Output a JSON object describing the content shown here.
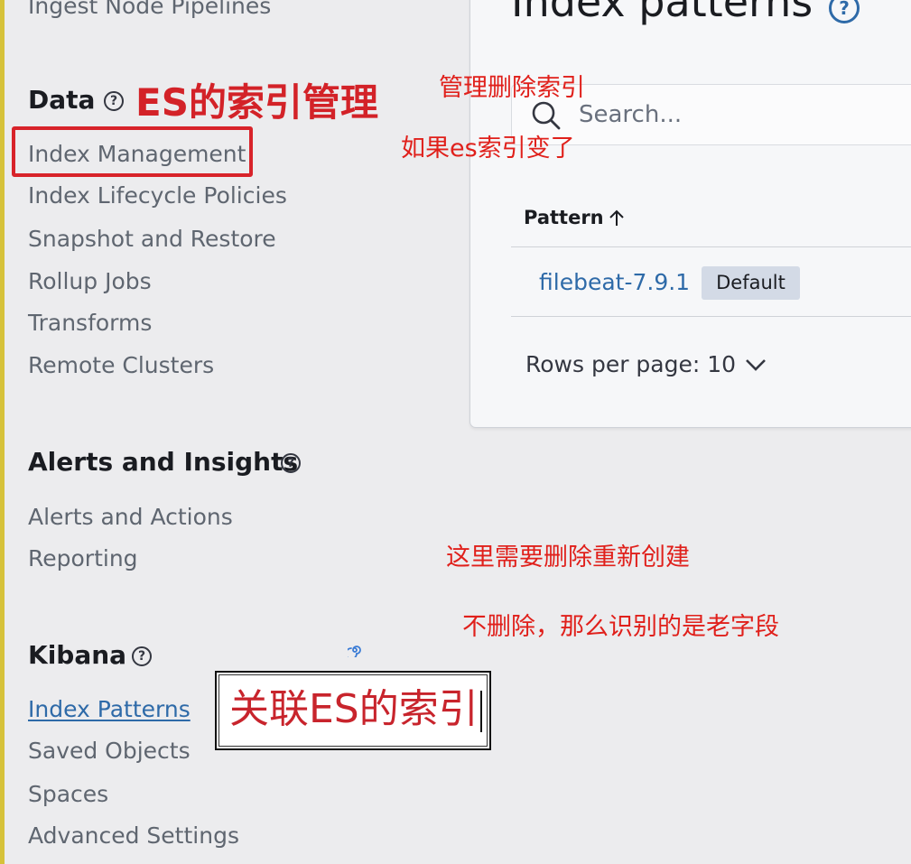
{
  "sidebar": {
    "top_cut_item": "Ingest Node Pipelines",
    "data_section": {
      "title": "Data",
      "items": [
        "Index Management",
        "Index Lifecycle Policies",
        "Snapshot and Restore",
        "Rollup Jobs",
        "Transforms",
        "Remote Clusters"
      ]
    },
    "alerts_section": {
      "title": "Alerts and Insights",
      "items": [
        "Alerts and Actions",
        "Reporting"
      ]
    },
    "kibana_section": {
      "title": "Kibana",
      "items": [
        "Index Patterns",
        "Saved Objects",
        "Spaces",
        "Advanced Settings"
      ],
      "active_item": "Index Patterns"
    },
    "help_glyph": "?"
  },
  "main": {
    "title": "Index patterns",
    "help_glyph": "?",
    "search": {
      "placeholder": "Search..."
    },
    "table": {
      "column_header": "Pattern",
      "sort": "ascending",
      "rows": [
        {
          "pattern": "filebeat-7.9.1",
          "badge": "Default"
        }
      ]
    },
    "pagination": {
      "rows_per_page_label": "Rows per page: 10"
    }
  },
  "annotations": {
    "es_index_management": "ES的索引管理",
    "manage_delete_index": "管理删除索引",
    "if_es_index_changed": "如果es索引变了",
    "need_delete_recreate": "这里需要删除重新创建",
    "not_delete_old_fields": "不删除，那么识别的是老字段",
    "textbox_link_es_index": "关联ES的索引"
  },
  "colors": {
    "background": "#ececee",
    "link": "#2e6aa8",
    "annotation_red": "#e0201b",
    "badge_bg": "#d3dae6"
  },
  "icons": {
    "search": "search-icon",
    "sort": "arrow-up-icon",
    "pagination": "chevron-down-icon",
    "help": "question-circle-icon"
  }
}
